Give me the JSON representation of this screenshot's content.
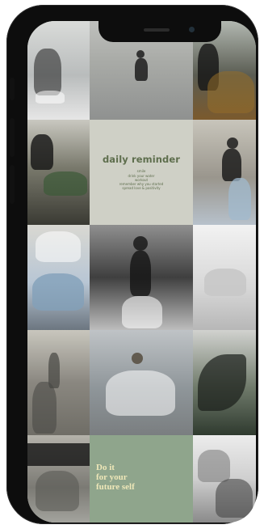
{
  "daily_reminder": {
    "title": "daily reminder",
    "lines": [
      "smile",
      "drink your water",
      "workout",
      "remember why you started",
      "spread love & positivity"
    ]
  },
  "quote": {
    "lines": [
      "Do it",
      "for your",
      "future self"
    ]
  },
  "colors": {
    "phone_frame": "#0d0d0d",
    "reminder_bg": "#cfd0c6",
    "reminder_text": "#5e6e4d",
    "quote_bg": "#8fa58c",
    "quote_text": "#eee7b8"
  },
  "icons": {
    "notch": "notch",
    "speaker": "speaker-icon",
    "camera": "camera-icon"
  }
}
